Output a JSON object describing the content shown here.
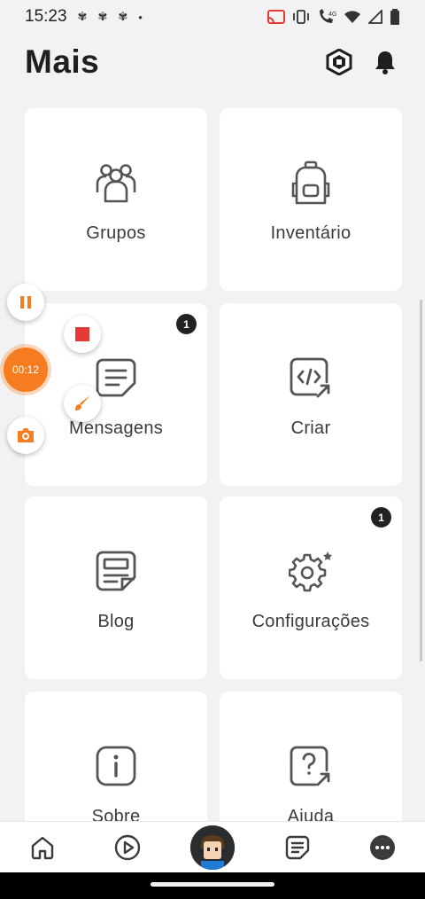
{
  "status_bar": {
    "time": "15:23",
    "left_icons": [
      "fan-icon",
      "fan-icon",
      "fan-icon",
      "dot-icon"
    ],
    "right_icons": [
      "cast-icon",
      "vibrate-icon",
      "wifi-call-icon",
      "wifi-icon",
      "signal-icon",
      "battery-icon"
    ],
    "network_label": "4G"
  },
  "header": {
    "title": "Mais",
    "icons": [
      "robux-icon",
      "bell-icon"
    ]
  },
  "tiles": [
    {
      "label": "Grupos",
      "icon": "groups-icon",
      "badge": ""
    },
    {
      "label": "Inventário",
      "icon": "backpack-icon",
      "badge": ""
    },
    {
      "label": "Mensagens",
      "icon": "messages-icon",
      "badge": "1"
    },
    {
      "label": "Criar",
      "icon": "create-icon",
      "badge": ""
    },
    {
      "label": "Blog",
      "icon": "blog-icon",
      "badge": ""
    },
    {
      "label": "Configurações",
      "icon": "settings-icon",
      "badge": "1"
    },
    {
      "label": "Sobre",
      "icon": "info-icon",
      "badge": ""
    },
    {
      "label": "Ajuda",
      "icon": "help-icon",
      "badge": ""
    }
  ],
  "recorder": {
    "timer": "00:12",
    "buttons": [
      "pause-icon",
      "stop-icon",
      "brush-icon",
      "camera-icon"
    ]
  },
  "bottom_nav": {
    "items": [
      "home-icon",
      "play-icon",
      "avatar",
      "chat-icon",
      "more-icon"
    ]
  },
  "colors": {
    "background": "#f2f2f2",
    "tile": "#ffffff",
    "accent_orange": "#f57c1f",
    "record_red": "#e53935"
  }
}
